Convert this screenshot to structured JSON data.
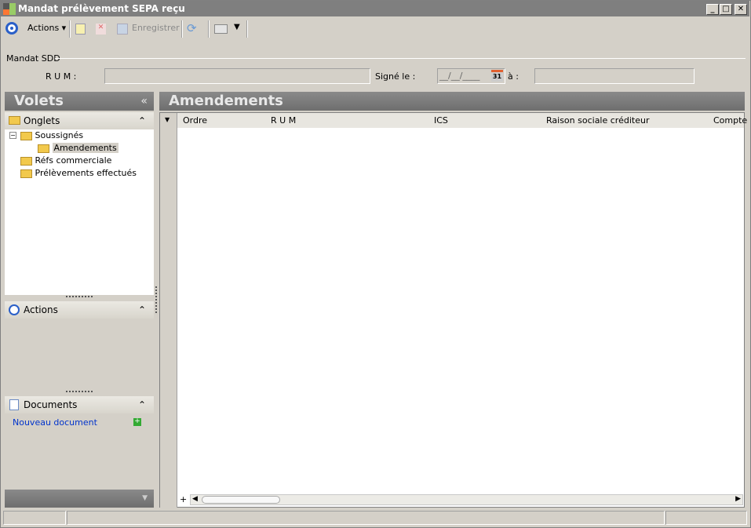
{
  "window": {
    "title": "Mandat prélèvement SEPA reçu",
    "min": "_",
    "max": "□",
    "close": "✕"
  },
  "toolbar": {
    "actions": "Actions",
    "save": "Enregistrer"
  },
  "header": {
    "group": "Mandat SDD",
    "rum_label": "R U M :",
    "rum_value": "",
    "signed_label": "Signé le :",
    "date_mask": "__/__/____",
    "calendar": "31",
    "to_label": "à :",
    "to_value": ""
  },
  "sidebar": {
    "title": "Volets",
    "collapse": "«",
    "tabs_title": "Onglets",
    "tree": [
      "Soussignés",
      "Amendements",
      "Réfs commerciale",
      "Prélèvements effectués"
    ],
    "actions_title": "Actions",
    "documents_title": "Documents",
    "new_document": "Nouveau document"
  },
  "main": {
    "title": "Amendements",
    "columns": [
      "Ordre",
      "R U M",
      "ICS",
      "Raison sociale créditeur",
      "Compte"
    ],
    "add": "+"
  }
}
